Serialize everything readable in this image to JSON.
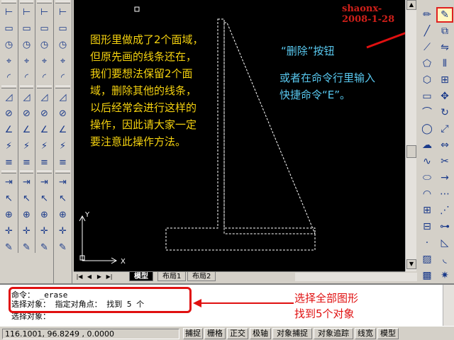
{
  "watermark": "shaonx-2008-1-28",
  "note_yellow": "图形里做成了2个面域，但原先画的线条还在，我们要想法保留2个面域，删除其他的线条，以后经常会进行这样的操作，因此请大家一定要注意此操作方法。",
  "note_cyan_title": "“删除”按钮",
  "note_cyan_body": "或者在命令行里输入快捷命令“E”。",
  "ucs": {
    "x_label": "X",
    "y_label": "Y"
  },
  "layout_tabs": [
    {
      "label": "模型",
      "active": true
    },
    {
      "label": "布局1",
      "active": false
    },
    {
      "label": "布局2",
      "active": false
    }
  ],
  "tab_nav": [
    "|◀",
    "◀",
    "▶",
    "▶|"
  ],
  "command_lines": [
    "命令： _erase",
    "选择对象： 指定对角点： 找到 5 个",
    "选择对象："
  ],
  "annotation": {
    "line1": "选择全部图形",
    "line2": "找到5个对象"
  },
  "status": {
    "coords": "116.1001, 96.8249 , 0.0000",
    "buttons": [
      "捕捉",
      "栅格",
      "正交",
      "极轴",
      "对象捕捉",
      "对象追踪",
      "线宽",
      "模型"
    ]
  },
  "left_toolbar_icons": [
    [
      "dimension-linear-icon",
      "dimension-aligned-icon",
      "dimension-arc-icon",
      "dimension-ordinate-icon",
      "dimension-radius-icon",
      "dimension-jogged-icon",
      "dimension-diameter-icon",
      "dimension-angular-icon",
      "quick-dimension-icon",
      "baseline-dimension-icon",
      "continue-dimension-icon",
      "leader-icon",
      "tolerance-icon",
      "center-mark-icon",
      "dimension-edit-icon"
    ],
    [
      "box-icon",
      "wedge-icon",
      "cone-icon",
      "sphere-icon",
      "cylinder-icon",
      "torus-icon",
      "pyramid-icon",
      "helix-icon",
      "planar-surface-icon",
      "extrude-icon",
      "presspull-icon",
      "sweep-icon",
      "revolve-icon",
      "loft-icon",
      "union-icon"
    ],
    [
      "sphere-3d-icon",
      "shade-icon",
      "render-icon",
      "camera-icon",
      "light-icon",
      "material-icon",
      "view-icon",
      "orbit-icon",
      "walk-icon",
      "fly-icon",
      "zoom-icon",
      "pan-icon",
      "ucs-icon",
      "layer-icon",
      "properties-icon"
    ]
  ],
  "right_toolbar_icons": [
    [
      "erase-icon",
      "line-icon",
      "construction-line-icon",
      "polyline-icon",
      "polygon-icon",
      "rectangle-icon",
      "arc-icon",
      "circle-icon",
      "revision-cloud-icon",
      "spline-icon",
      "ellipse-icon",
      "ellipse-arc-icon",
      "insert-block-icon",
      "make-block-icon",
      "point-icon",
      "hatch-icon",
      "gradient-icon",
      "region-icon",
      "table-icon",
      "multiline-text-icon"
    ],
    [
      "highlighter-icon",
      "copy-icon",
      "mirror-icon",
      "offset-icon",
      "array-icon",
      "move-icon",
      "rotate-icon",
      "scale-icon",
      "stretch-icon",
      "trim-icon",
      "extend-icon",
      "break-at-point-icon",
      "break-icon",
      "join-icon",
      "chamfer-icon",
      "fillet-icon",
      "explode-icon"
    ]
  ]
}
